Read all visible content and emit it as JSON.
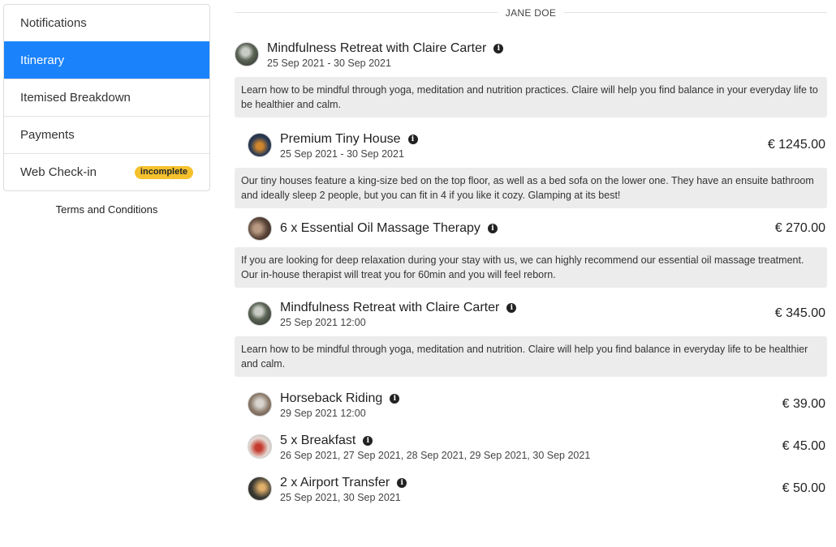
{
  "sidebar": {
    "items": [
      {
        "label": "Notifications"
      },
      {
        "label": "Itinerary"
      },
      {
        "label": "Itemised Breakdown"
      },
      {
        "label": "Payments"
      },
      {
        "label": "Web Check-in",
        "badge": "incomplete"
      }
    ],
    "terms_link": "Terms and Conditions"
  },
  "guest_name": "JANE DOE",
  "itinerary": [
    {
      "title": "Mindfulness Retreat with Claire Carter",
      "date": "25 Sep 2021 - 30 Sep 2021",
      "price": "",
      "description": "Learn how to be mindful through yoga, meditation and nutrition practices. Claire will help you find balance in your everyday life to be healthier and calm."
    },
    {
      "title": "Premium Tiny House",
      "date": "25 Sep 2021 - 30 Sep 2021",
      "price": "€ 1245.00",
      "description": "Our tiny houses feature a king-size bed on the top floor, as well as a bed sofa on the lower one. They have an ensuite bathroom and ideally sleep 2 people, but you can fit in 4 if you like it cozy. Glamping at its best!"
    },
    {
      "title": "6 x Essential Oil Massage Therapy",
      "date": "",
      "price": "€ 270.00",
      "description": "If you are looking for deep relaxation during your stay with us, we can highly recommend our essential oil massage treatment. Our in-house therapist will treat you for 60min and you will feel reborn."
    },
    {
      "title": "Mindfulness Retreat with Claire Carter",
      "date": "25 Sep 2021 12:00",
      "price": "€ 345.00",
      "description": "Learn how to be mindful through yoga, meditation and nutrition. Claire will help you find balance in everyday life to be healthier and calm."
    },
    {
      "title": "Horseback Riding",
      "date": "29 Sep 2021 12:00",
      "price": "€ 39.00"
    },
    {
      "title": "5 x Breakfast",
      "date": "26 Sep 2021, 27 Sep 2021, 28 Sep 2021, 29 Sep 2021, 30 Sep 2021",
      "price": "€ 45.00"
    },
    {
      "title": "2 x Airport Transfer",
      "date": "25 Sep 2021, 30 Sep 2021",
      "price": "€ 50.00"
    }
  ],
  "icons": {
    "info": "info-circle-icon"
  },
  "colors": {
    "active": "#1a82fb",
    "badge": "#f5c12c",
    "description_bg": "#ececec"
  }
}
